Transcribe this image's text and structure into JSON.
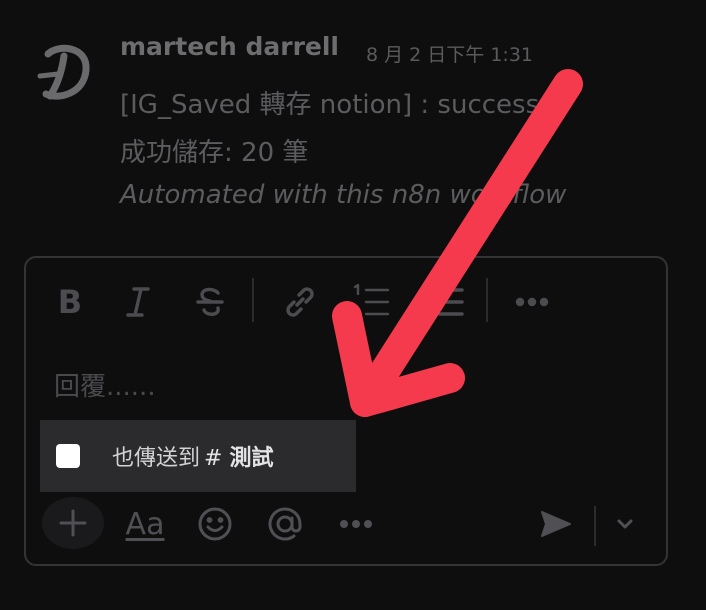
{
  "message": {
    "author": "martech darrell",
    "timestamp": "8 月 2 日下午 1:31",
    "lines": [
      "[IG_Saved 轉存 notion] : success",
      "成功儲存: 20 筆",
      "Automated with this n8n workflow"
    ]
  },
  "composer": {
    "placeholder": "回覆......",
    "toolbar": [
      "bold-icon",
      "italic-icon",
      "strikethrough-icon",
      "link-icon",
      "numbered-list-icon",
      "bulleted-list-icon",
      "more-icon"
    ],
    "also_send": {
      "label": "也傳送到",
      "hash": "#",
      "channel": "測試",
      "checked": false
    },
    "bottom": {
      "aa_label": "Aa",
      "icons": [
        "plus-icon",
        "formatting-icon",
        "emoji-icon",
        "mention-icon",
        "more-icon",
        "send-icon",
        "chevron-down-icon"
      ]
    }
  },
  "colors": {
    "background": "#0e0e0f",
    "arrow": "#f43a4c",
    "popup": "#2b2b2d"
  }
}
